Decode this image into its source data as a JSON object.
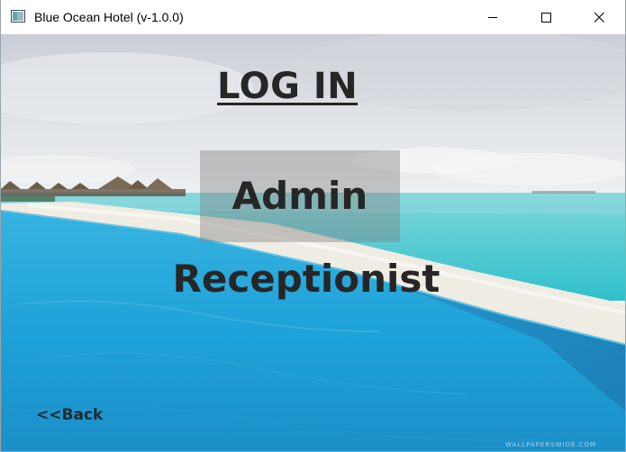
{
  "window": {
    "title": "Blue Ocean Hotel (v-1.0.0)",
    "controls": {
      "minimize": "minimize-icon",
      "maximize": "maximize-icon",
      "close": "close-icon"
    }
  },
  "login": {
    "heading": "LOG IN",
    "admin_label": "Admin",
    "receptionist_label": "Receptionist",
    "back_label": "<<Back"
  },
  "background": {
    "description_icon": "beach-resort-photo",
    "colors": {
      "sky": "#dfe3e8",
      "sea": "#3fc1cf",
      "pool": "#1d9fd6",
      "sand": "#f1efe9"
    },
    "watermark": "WALLPAPERSWIDE.COM"
  }
}
